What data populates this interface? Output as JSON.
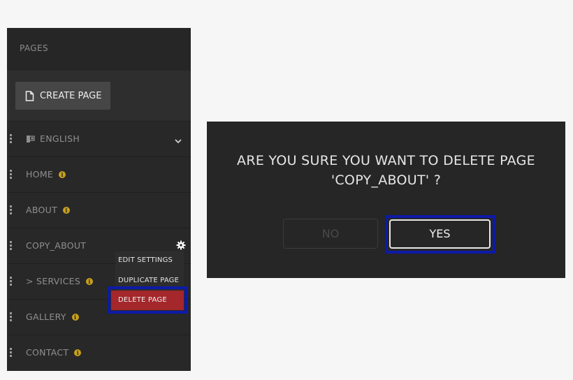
{
  "panel": {
    "title": "PAGES",
    "create_label": "CREATE PAGE",
    "language": "ENGLISH",
    "items": [
      {
        "label": "HOME"
      },
      {
        "label": "ABOUT"
      },
      {
        "label": "COPY_ABOUT"
      },
      {
        "label": "> SERVICES"
      },
      {
        "label": "GALLERY"
      },
      {
        "label": "CONTACT"
      }
    ],
    "info_glyph": "i"
  },
  "context_menu": {
    "edit": "EDIT SETTINGS",
    "duplicate": "DUPLICATE PAGE",
    "delete": "DELETE PAGE"
  },
  "dialog": {
    "line1": "ARE YOU SURE YOU WANT TO DELETE PAGE",
    "line2": "'COPY_ABOUT' ?",
    "no_label": "NO",
    "yes_label": "YES"
  },
  "colors": {
    "panel_bg": "#282828",
    "accent_info": "#c8a11a",
    "delete_red": "#a3272b",
    "highlight_blue": "#0d1aa8"
  }
}
